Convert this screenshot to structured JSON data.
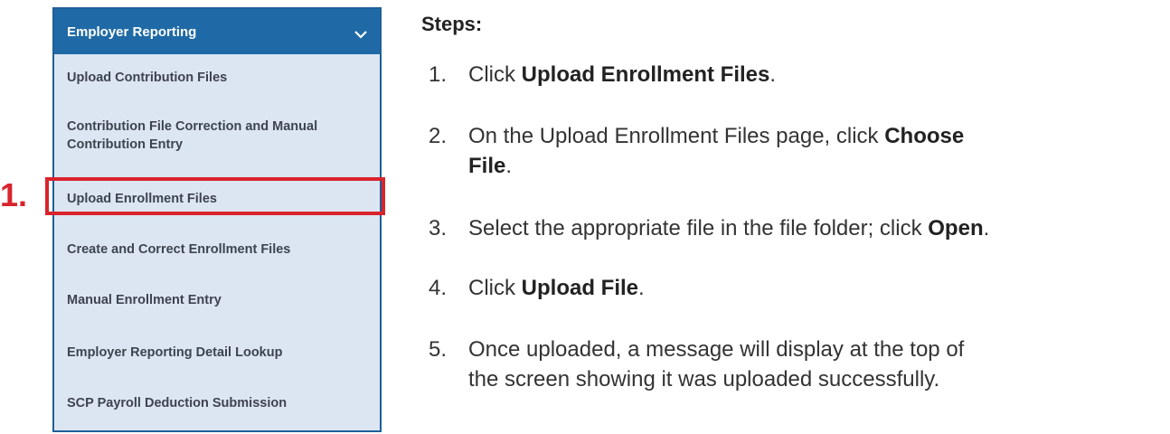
{
  "menu": {
    "header": "Employer Reporting",
    "header_icon": "chevron-down-icon",
    "items": [
      {
        "label": "Upload Contribution Files"
      },
      {
        "label_line1": "Contribution File Correction and Manual",
        "label_line2": "Contribution Entry"
      },
      {
        "label": "Upload Enrollment Files"
      },
      {
        "label": "Create and Correct Enrollment Files"
      },
      {
        "label": "Manual Enrollment Entry"
      },
      {
        "label": "Employer Reporting Detail Lookup"
      },
      {
        "label": "SCP Payroll Deduction Submission"
      }
    ]
  },
  "callout": {
    "number": "1.",
    "color": "#d9232d"
  },
  "steps": {
    "title": "Steps:",
    "list": [
      {
        "num": "1.",
        "pre": "Click ",
        "bold": "Upload Enrollment Files",
        "post": "."
      },
      {
        "num": "2.",
        "pre": "On the Upload Enrollment Files page, click ",
        "bold": "Choose",
        "line2_bold": "File",
        "post": "."
      },
      {
        "num": "3.",
        "pre": "Select the appropriate file in the file folder; click ",
        "bold": "Open",
        "post": "."
      },
      {
        "num": "4.",
        "pre": "Click ",
        "bold": "Upload File",
        "post": "."
      },
      {
        "num": "5.",
        "line1": "Once uploaded, a message will display at the top of",
        "line2": "the screen showing it was uploaded successfully."
      }
    ]
  },
  "colors": {
    "header_bg": "#1f6aa6",
    "menu_bg": "#dce6f2",
    "highlight": "#d9232d"
  }
}
